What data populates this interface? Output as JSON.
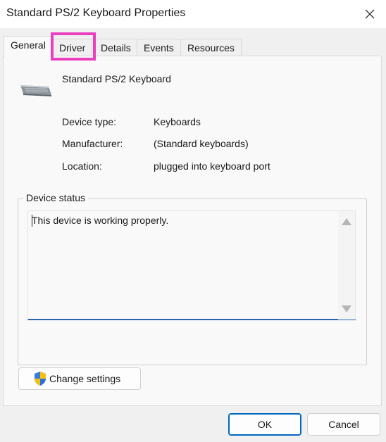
{
  "window": {
    "title": "Standard PS/2 Keyboard Properties"
  },
  "tabs": [
    {
      "label": "General",
      "active": true
    },
    {
      "label": "Driver",
      "active": false
    },
    {
      "label": "Details",
      "active": false
    },
    {
      "label": "Events",
      "active": false
    },
    {
      "label": "Resources",
      "active": false
    }
  ],
  "device": {
    "name": "Standard PS/2 Keyboard",
    "icon": "keyboard-icon"
  },
  "properties": [
    {
      "label": "Device type:",
      "value": "Keyboards"
    },
    {
      "label": "Manufacturer:",
      "value": "(Standard keyboards)"
    },
    {
      "label": "Location:",
      "value": "plugged into keyboard port"
    }
  ],
  "status": {
    "group_label": "Device status",
    "text": "This device is working properly."
  },
  "buttons": {
    "change_settings": "Change settings",
    "ok": "OK",
    "cancel": "Cancel"
  },
  "colors": {
    "highlight": "#ea3fbf",
    "accent": "#0067c0"
  }
}
